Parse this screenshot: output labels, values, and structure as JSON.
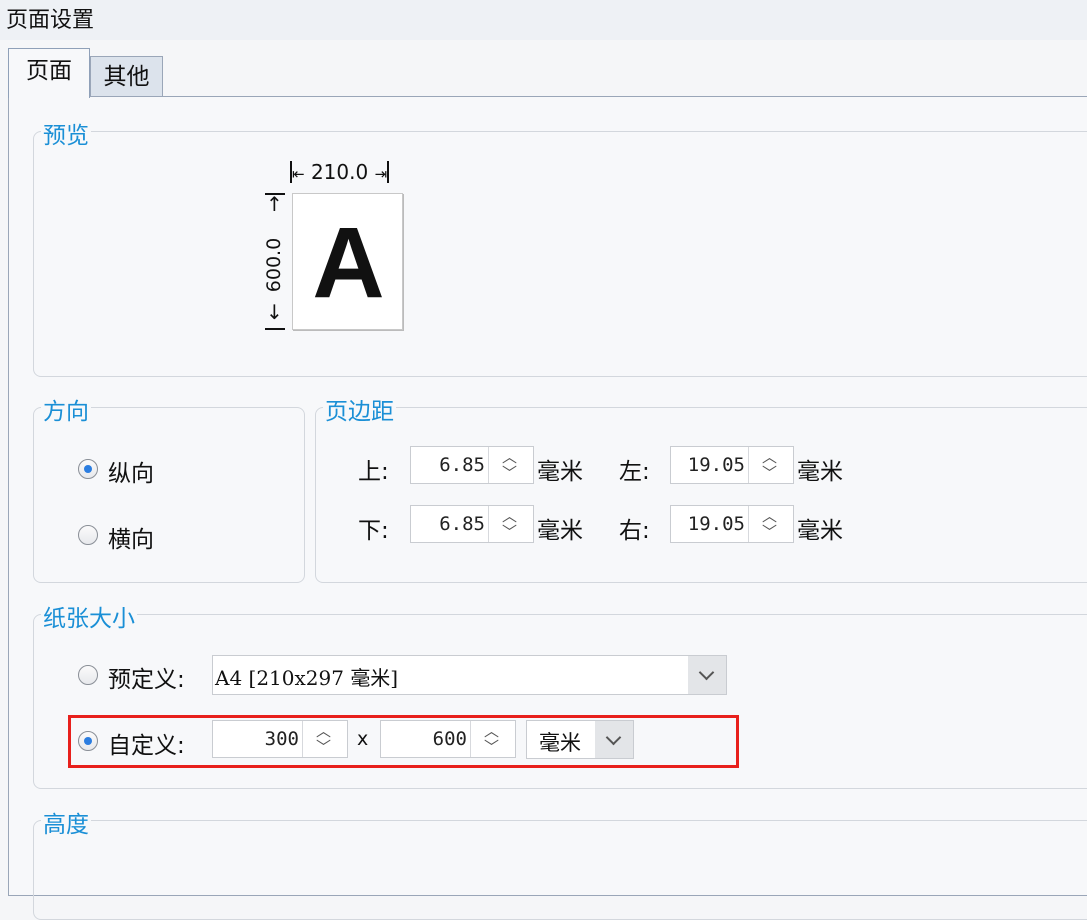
{
  "window": {
    "title": "页面设置"
  },
  "tabs": [
    {
      "label": "页面"
    },
    {
      "label": "其他"
    }
  ],
  "preview": {
    "legend": "预览",
    "width_label": "210.0",
    "height_label": "600.0",
    "letter": "A"
  },
  "orientation": {
    "legend": "方向",
    "portrait": "纵向",
    "landscape": "横向",
    "selected": "portrait"
  },
  "margins": {
    "legend": "页边距",
    "top_label": "上:",
    "top_value": "6.85",
    "bottom_label": "下:",
    "bottom_value": "6.85",
    "left_label": "左:",
    "left_value": "19.05",
    "right_label": "右:",
    "right_value": "19.05",
    "unit": "毫米"
  },
  "paper": {
    "legend": "纸张大小",
    "predefined_label": "预定义:",
    "predefined_value": "A4 [210x297 毫米]",
    "custom_label": "自定义:",
    "custom_width": "300",
    "custom_height": "600",
    "times": "x",
    "unit_value": "毫米",
    "selected": "custom"
  },
  "height_section": {
    "legend": "高度"
  },
  "colors": {
    "accent": "#1a8fd6",
    "highlight": "#e8201c",
    "radio_dot": "#2b7de0"
  }
}
